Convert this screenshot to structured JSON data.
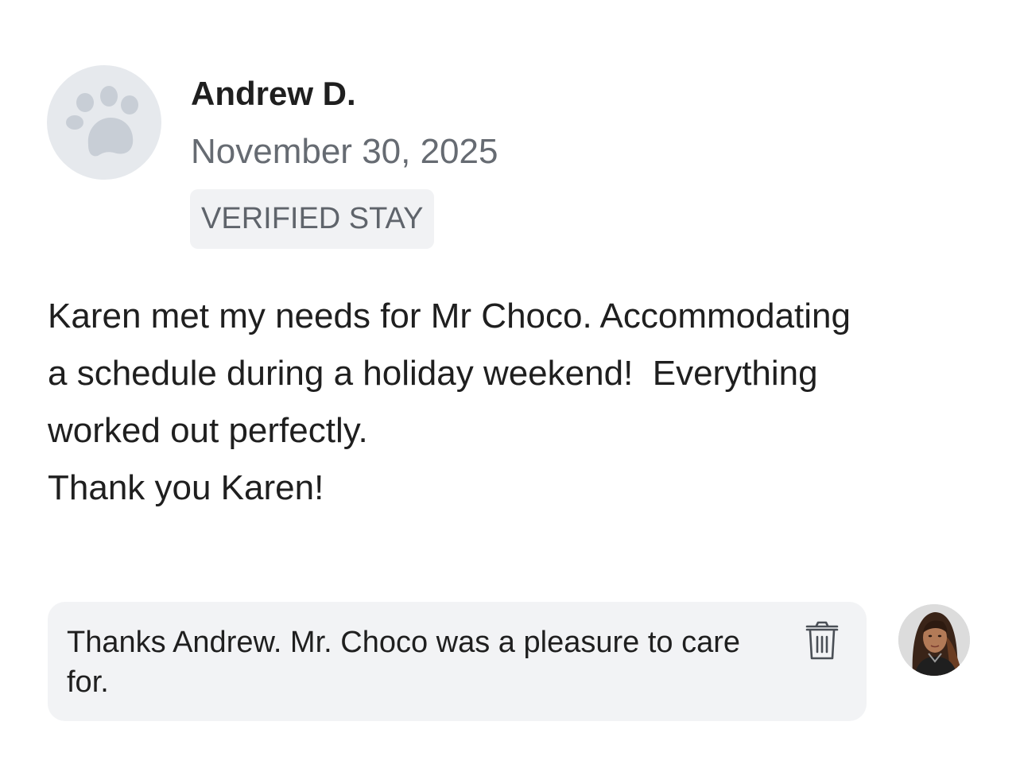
{
  "review": {
    "reviewer_name": "Andrew D.",
    "date": "November 30, 2025",
    "badge": "VERIFIED STAY",
    "avatar_icon": "paw-icon",
    "body_lines": [
      "Karen met my needs for Mr Choco. Accommodating",
      "a schedule during a holiday weekend!  Everything",
      "worked out perfectly.",
      "Thank you Karen!"
    ]
  },
  "reply": {
    "text": "Thanks Andrew. Mr. Choco was a pleasure to care for.",
    "delete_icon": "trash-icon",
    "avatar_icon": "profile-photo"
  },
  "colors": {
    "avatar_bg": "#e6e9ed",
    "paw": "#c8ced6",
    "badge_bg": "#f1f2f4",
    "reply_bg": "#f2f3f5",
    "muted_text": "#666b72"
  }
}
